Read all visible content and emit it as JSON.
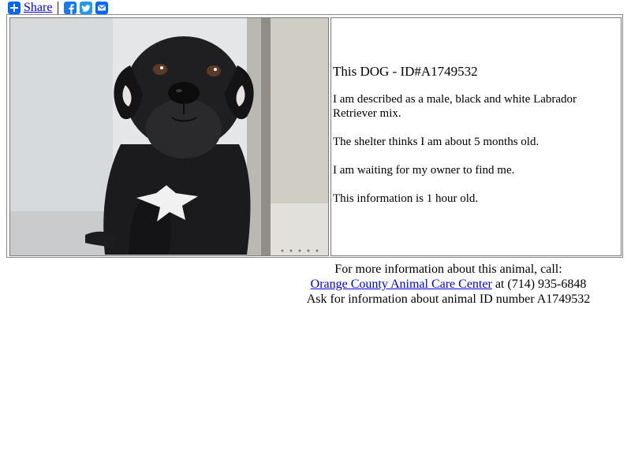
{
  "share": {
    "label": "Share",
    "services": [
      "facebook-icon",
      "twitter-icon",
      "email-icon"
    ],
    "accent": "#0166ff"
  },
  "animal": {
    "photo_alt": "black puppy sitting in shelter kennel",
    "title": "This DOG - ID#A1749532",
    "description": "I am described as a male, black and white Labrador Retriever mix.",
    "age": "The shelter thinks I am about 5 months old.",
    "waiting": "I am waiting for my owner to find me.",
    "freshness": "This information is 1 hour old."
  },
  "contact": {
    "line1": "For more information about this animal, call:",
    "center_name": "Orange County Animal Care Center",
    "phone": " at (714) 935-6848",
    "line3": "Ask for information about animal ID number A1749532",
    "link_color": "#0000ee"
  }
}
